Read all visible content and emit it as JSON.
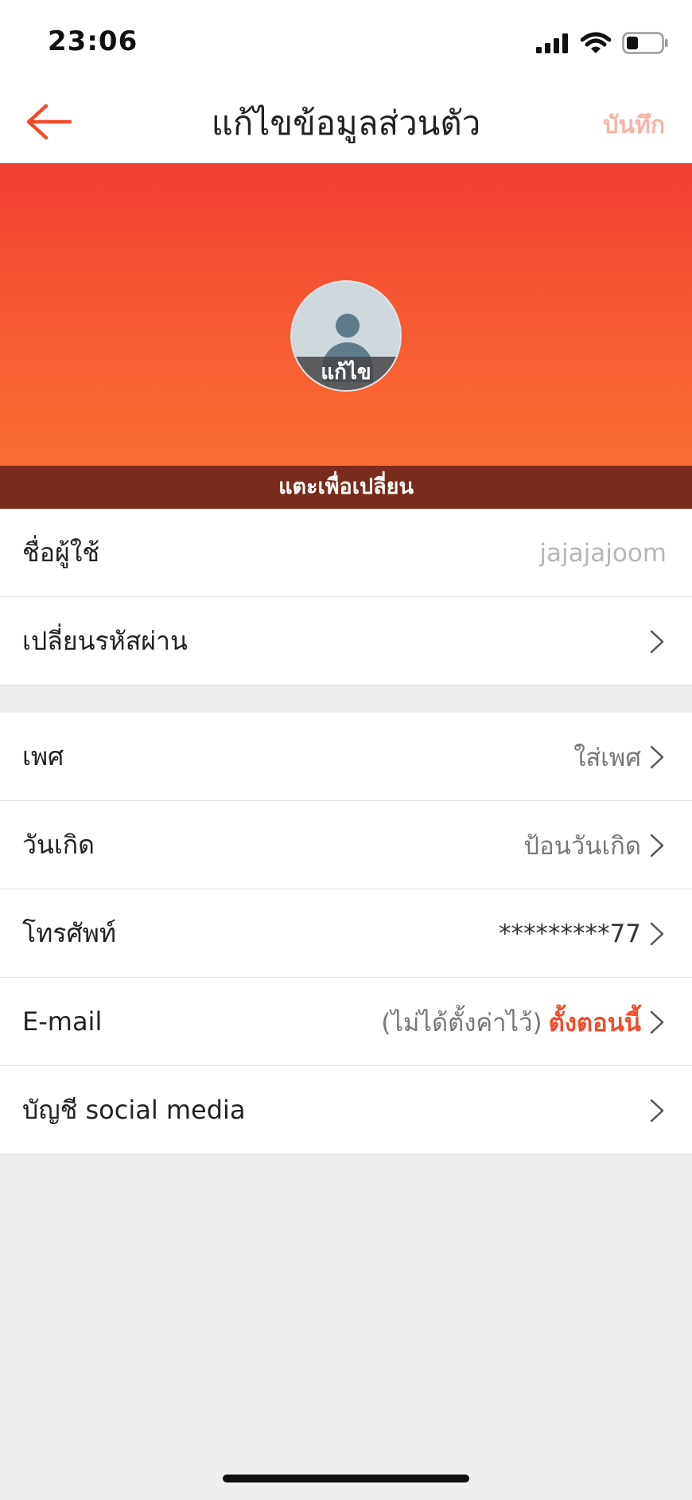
{
  "status_bar": {
    "time": "23:06"
  },
  "nav": {
    "title": "แก้ไขข้อมูลส่วนตัว",
    "save_label": "บันทึก"
  },
  "header": {
    "avatar_edit_label": "แก้ไข",
    "tap_to_change": "แตะเพื่อเปลี่ยน"
  },
  "account": {
    "username_label": "ชื่อผู้ใช้",
    "username_value": "jajajajoom",
    "password_label": "เปลี่ยนรหัสผ่าน"
  },
  "profile": {
    "gender_label": "เพศ",
    "gender_value": "ใส่เพศ",
    "birthday_label": "วันเกิด",
    "birthday_value": "ป้อนวันเกิด",
    "phone_label": "โทรศัพท์",
    "phone_value": "*********77",
    "email_label": "E-mail",
    "email_status": "(ไม่ได้ตั้งค่าไว้)",
    "email_action": "ตั้งตอนนี้",
    "social_label": "บัญชี social media"
  },
  "colors": {
    "accent": "#ee4d2d",
    "header_top": "#f23f31",
    "header_bottom": "#fb6c32",
    "tap_bar": "#7a2c1b"
  }
}
